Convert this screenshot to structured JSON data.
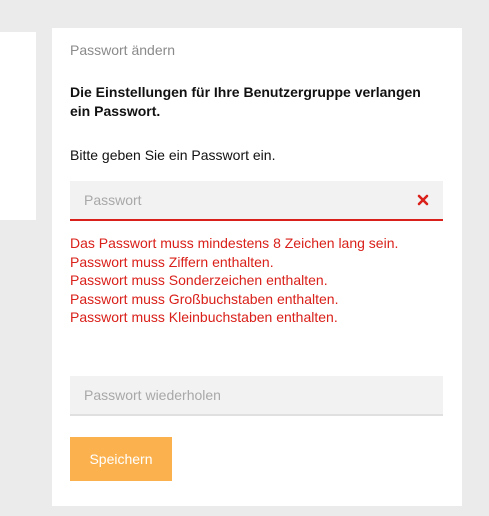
{
  "dialog": {
    "title": "Passwort ändern",
    "notice": "Die Einstellungen für Ihre Benutzergruppe verlangen ein Passwort.",
    "prompt": "Bitte geben Sie ein Passwort ein."
  },
  "password_field": {
    "placeholder": "Passwort",
    "value": "",
    "clear_icon": "close-x-icon"
  },
  "errors": [
    "Das Passwort muss mindestens 8 Zeichen lang sein.",
    "Passwort muss Ziffern enthalten.",
    "Passwort muss Sonderzeichen enthalten.",
    "Passwort muss Großbuchstaben enthalten.",
    "Passwort muss Kleinbuchstaben enthalten."
  ],
  "repeat_field": {
    "placeholder": "Passwort wiederholen",
    "value": ""
  },
  "buttons": {
    "save_label": "Speichern"
  },
  "colors": {
    "error": "#d9201a",
    "button": "#fbb24e",
    "background": "#ebebeb",
    "card": "#ffffff"
  }
}
